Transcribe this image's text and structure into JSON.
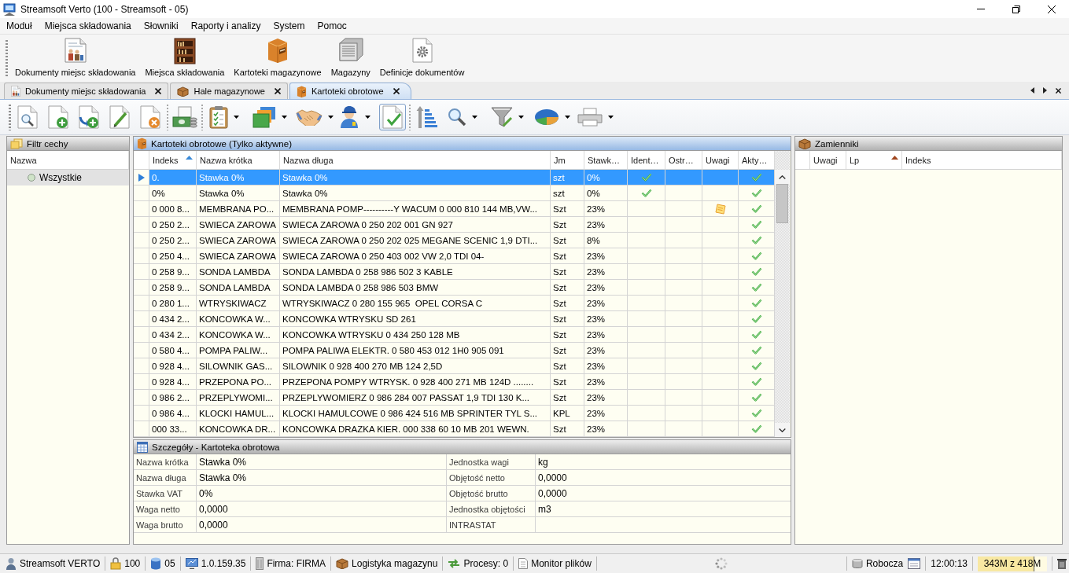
{
  "window": {
    "title": "Streamsoft Verto (100 - Streamsoft - 05)"
  },
  "menu": [
    "Moduł",
    "Miejsca składowania",
    "Słowniki",
    "Raporty i analizy",
    "System",
    "Pomoc"
  ],
  "launcher": [
    "Dokumenty miejsc składowania",
    "Miejsca składowania",
    "Kartoteki magazynowe",
    "Magazyny",
    "Definicje dokumentów"
  ],
  "open_tabs": [
    {
      "label": "Dokumenty miejsc składowania",
      "selected": false
    },
    {
      "label": "Hale magazynowe",
      "selected": false
    },
    {
      "label": "Kartoteki obrotowe",
      "selected": true
    }
  ],
  "toolbar": {
    "groups": [
      [
        {
          "dropdown": false,
          "pressed": false
        },
        {
          "dropdown": false,
          "pressed": false
        },
        {
          "dropdown": false,
          "pressed": false
        },
        {
          "dropdown": false,
          "pressed": false
        },
        {
          "dropdown": false,
          "pressed": false
        }
      ],
      [
        {
          "dropdown": false,
          "pressed": false
        }
      ],
      [
        {
          "dropdown": true,
          "pressed": false
        },
        {
          "dropdown": true,
          "pressed": false
        },
        {
          "dropdown": true,
          "pressed": false
        },
        {
          "dropdown": true,
          "pressed": false
        },
        {
          "dropdown": false,
          "pressed": true
        }
      ],
      [
        {
          "dropdown": false,
          "pressed": false
        },
        {
          "dropdown": true,
          "pressed": false
        },
        {
          "dropdown": true,
          "pressed": false
        },
        {
          "dropdown": true,
          "pressed": false
        },
        {
          "dropdown": true,
          "pressed": false
        }
      ]
    ]
  },
  "filter_panel": {
    "title": "Filtr cechy",
    "focused": false,
    "column": "Nazwa",
    "items": [
      {
        "label": "Wszystkie",
        "selected": true
      }
    ]
  },
  "grid": {
    "title": "Kartoteki obrotowe (Tylko aktywne)",
    "focused": true,
    "columns": [
      {
        "label": "Indeks",
        "sorted": true
      },
      {
        "label": "Nazwa krótka",
        "sorted": false
      },
      {
        "label": "Nazwa długa",
        "sorted": false
      },
      {
        "label": "Jm",
        "sorted": false
      },
      {
        "label": "Stawk…",
        "sorted": false
      },
      {
        "label": "Ident…",
        "sorted": false
      },
      {
        "label": "Ostr…",
        "sorted": false
      },
      {
        "label": "Uwagi",
        "sorted": false
      },
      {
        "label": "Akty…",
        "sorted": false
      }
    ],
    "rows": [
      {
        "selected": true,
        "cells": [
          "0.",
          "Stawka 0%",
          "Stawka 0%",
          "szt",
          "0%"
        ],
        "identified": true,
        "note": false,
        "active": true
      },
      {
        "selected": false,
        "cells": [
          "0%",
          "Stawka 0%",
          "Stawka 0%",
          "szt",
          "0%"
        ],
        "identified": true,
        "note": false,
        "active": true
      },
      {
        "selected": false,
        "cells": [
          "0 000 8...",
          "MEMBRANA PO...",
          "MEMBRANA POMP----------Y WACUM 0 000 810 144 MB,VW...",
          "Szt",
          "23%"
        ],
        "identified": false,
        "note": true,
        "active": true
      },
      {
        "selected": false,
        "cells": [
          "0 250 2...",
          "SWIECA ZAROWA",
          "SWIECA ZAROWA 0 250 202 001 GN 927",
          "Szt",
          "23%"
        ],
        "identified": false,
        "note": false,
        "active": true
      },
      {
        "selected": false,
        "cells": [
          "0 250 2...",
          "SWIECA ZAROWA",
          "SWIECA ZAROWA 0 250 202 025 MEGANE SCENIC 1,9 DTI...",
          "Szt",
          "8%"
        ],
        "identified": false,
        "note": false,
        "active": true
      },
      {
        "selected": false,
        "cells": [
          "0 250 4...",
          "SWIECA ZAROWA",
          "SWIECA ZAROWA 0 250 403 002 VW 2,0 TDI 04-",
          "Szt",
          "23%"
        ],
        "identified": false,
        "note": false,
        "active": true
      },
      {
        "selected": false,
        "cells": [
          "0 258 9...",
          "SONDA LAMBDA",
          "SONDA LAMBDA 0 258 986 502 3 KABLE",
          "Szt",
          "23%"
        ],
        "identified": false,
        "note": false,
        "active": true
      },
      {
        "selected": false,
        "cells": [
          "0 258 9...",
          "SONDA LAMBDA",
          "SONDA LAMBDA 0 258 986 503 BMW",
          "Szt",
          "23%"
        ],
        "identified": false,
        "note": false,
        "active": true
      },
      {
        "selected": false,
        "cells": [
          "0 280 1...",
          "WTRYSKIWACZ",
          "WTRYSKIWACZ 0 280 155 965  OPEL CORSA C",
          "Szt",
          "23%"
        ],
        "identified": false,
        "note": false,
        "active": true
      },
      {
        "selected": false,
        "cells": [
          "0 434 2...",
          "KONCOWKA W...",
          "KONCOWKA WTRYSKU SD 261",
          "Szt",
          "23%"
        ],
        "identified": false,
        "note": false,
        "active": true
      },
      {
        "selected": false,
        "cells": [
          "0 434 2...",
          "KONCOWKA W...",
          "KONCOWKA WTRYSKU 0 434 250 128 MB",
          "Szt",
          "23%"
        ],
        "identified": false,
        "note": false,
        "active": true
      },
      {
        "selected": false,
        "cells": [
          "0 580 4...",
          "POMPA PALIW...",
          "POMPA PALIWA ELEKTR. 0 580 453 012 1H0 905 091",
          "Szt",
          "23%"
        ],
        "identified": false,
        "note": false,
        "active": true
      },
      {
        "selected": false,
        "cells": [
          "0 928 4...",
          "SILOWNIK GAS...",
          "SILOWNIK 0 928 400 270 MB 124 2,5D",
          "Szt",
          "23%"
        ],
        "identified": false,
        "note": false,
        "active": true
      },
      {
        "selected": false,
        "cells": [
          "0 928 4...",
          "PRZEPONA PO...",
          "PRZEPONA POMPY WTRYSK. 0 928 400 271 MB 124D ........",
          "Szt",
          "23%"
        ],
        "identified": false,
        "note": false,
        "active": true
      },
      {
        "selected": false,
        "cells": [
          "0 986 2...",
          "PRZEPLYWOMI...",
          "PRZEPLYWOMIERZ 0 986 284 007 PASSAT 1,9 TDI 130 K...",
          "Szt",
          "23%"
        ],
        "identified": false,
        "note": false,
        "active": true
      },
      {
        "selected": false,
        "cells": [
          "0 986 4...",
          "KLOCKI HAMUL...",
          "KLOCKI HAMULCOWE 0 986 424 516 MB SPRINTER TYL S...",
          "KPL",
          "23%"
        ],
        "identified": false,
        "note": false,
        "active": true
      },
      {
        "selected": false,
        "cells": [
          "000 33...",
          "KONCOWKA DR...",
          "KONCOWKA DRAZKA KIER. 000 338 60 10 MB 201 WEWN.",
          "Szt",
          "23%"
        ],
        "identified": false,
        "note": false,
        "active": true
      }
    ]
  },
  "details": {
    "title": "Szczegóły - Kartoteka obrotowa",
    "focused": false,
    "left": [
      {
        "label": "Nazwa krótka",
        "value": "Stawka 0%"
      },
      {
        "label": "Nazwa długa",
        "value": "Stawka 0%"
      },
      {
        "label": "Stawka VAT",
        "value": "0%"
      },
      {
        "label": "Waga netto",
        "value": "0,0000"
      },
      {
        "label": "Waga brutto",
        "value": "0,0000"
      }
    ],
    "right": [
      {
        "label": "Jednostka wagi",
        "value": "kg"
      },
      {
        "label": "Objętość netto",
        "value": "0,0000"
      },
      {
        "label": "Objętość brutto",
        "value": "0,0000"
      },
      {
        "label": "Jednostka objętości",
        "value": "m3"
      },
      {
        "label": "INTRASTAT"
      }
    ]
  },
  "substitutes": {
    "title": "Zamienniki",
    "focused": false,
    "columns": [
      {
        "label": "Uwagi",
        "sorted": false
      },
      {
        "label": "Lp",
        "sorted": true
      },
      {
        "label": "Indeks",
        "sorted": false
      }
    ]
  },
  "status_bar": {
    "items": [
      "Streamsoft VERTO",
      "100",
      "05",
      "1.0.159.35",
      "Firma: FIRMA",
      "Logistyka magazynu",
      "Procesy: 0",
      "Monitor plików"
    ],
    "workspace": "Robocza",
    "clock": "12:00:13",
    "memory": {
      "text": "343M z 418M",
      "level": 0.82
    }
  }
}
